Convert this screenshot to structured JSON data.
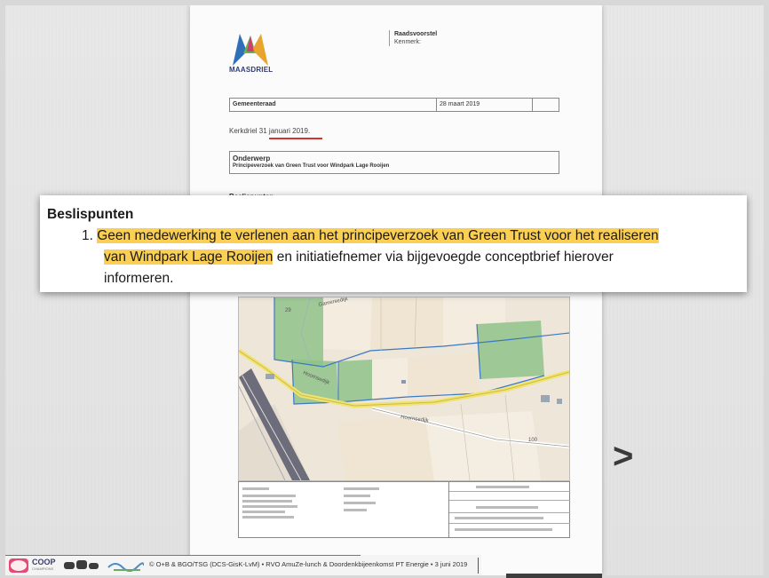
{
  "document": {
    "logo_text": "MAASDRIEL",
    "doc_type": "Raadsvoorstel",
    "kenmerk_label": "Kenmerk:",
    "council": "Gemeenteraad",
    "meeting_date": "28 maart 2019",
    "place_date": "Kerkdriel 31 januari 2019.",
    "subject_heading": "Onderwerp",
    "subject_text": "Principeverzoek van Green Trust voor Windpark Lage Rooijen",
    "beslispunten_small": "Beslispunten",
    "map_labels": [
      "Hoornsedijk",
      "Gamersedijk",
      "Hoornsedijk",
      "100",
      "29"
    ]
  },
  "callout": {
    "heading": "Beslispunten",
    "item_number": "1.",
    "highlight_1": "Geen medewerking te verlenen aan het principeverzoek van Green Trust voor het realiseren",
    "highlight_2": "van Windpark Lage Rooijen",
    "rest_line2": " en initiatiefnemer via bijgevoegde conceptbrief hierover",
    "line3": "informeren."
  },
  "navigation": {
    "next_label": ">"
  },
  "footer": {
    "coop": "COOP",
    "coop_sub": "CHAMPIONS",
    "text": "© O+B & BGO/TSG (DCS-GisK-LvM) • RVO AmuZe-lunch & Doordenkbijeenkomst PT Energie • 3 juni 2019"
  },
  "colors": {
    "highlight": "#fbcf54",
    "underline": "#d8322c",
    "logo_blue": "#2f3b79",
    "logo_green": "#6ab04c"
  }
}
